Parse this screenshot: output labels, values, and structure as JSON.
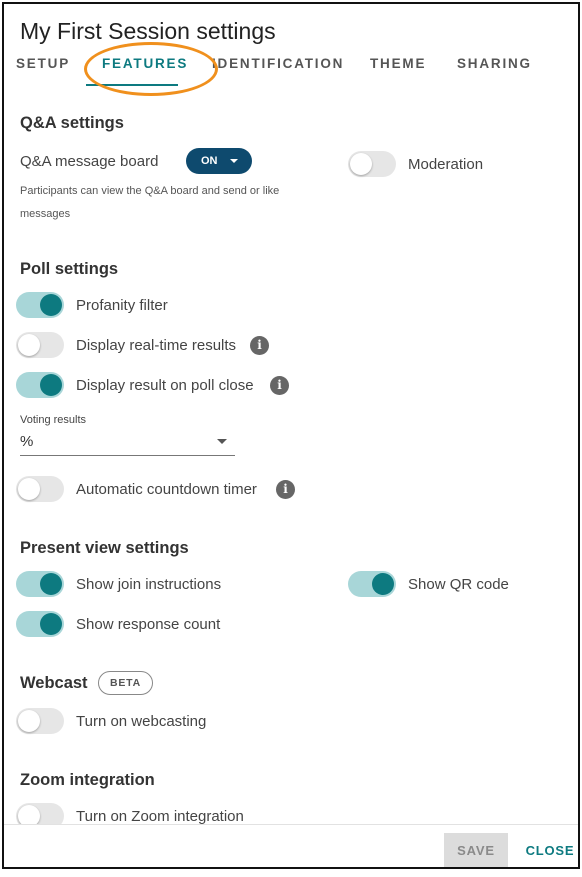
{
  "dialog": {
    "title": "My First Session settings"
  },
  "tabs": [
    {
      "label": "SETUP",
      "active": false
    },
    {
      "label": "FEATURES",
      "active": true
    },
    {
      "label": "IDENTIFICATION",
      "active": false
    },
    {
      "label": "THEME",
      "active": false
    },
    {
      "label": "SHARING",
      "active": false
    }
  ],
  "qa": {
    "title": "Q&A settings",
    "message_board_label": "Q&A message board",
    "message_board_value": "ON",
    "help_text": "Participants can view the Q&A board and send or like messages",
    "moderation_label": "Moderation",
    "moderation_on": false
  },
  "poll": {
    "title": "Poll settings",
    "profanity_label": "Profanity filter",
    "profanity_on": true,
    "realtime_label": "Display real-time results",
    "realtime_on": false,
    "on_close_label": "Display result on poll close",
    "on_close_on": true,
    "voting_results_label": "Voting results",
    "voting_results_value": "%",
    "countdown_label": "Automatic countdown timer",
    "countdown_on": false
  },
  "present": {
    "title": "Present view settings",
    "join_label": "Show join instructions",
    "join_on": true,
    "qr_label": "Show QR code",
    "qr_on": true,
    "response_label": "Show response count",
    "response_on": true
  },
  "webcast": {
    "title": "Webcast",
    "badge": "BETA",
    "toggle_label": "Turn on webcasting",
    "toggle_on": false
  },
  "zoom": {
    "title": "Zoom integration",
    "toggle_label": "Turn on Zoom integration",
    "toggle_on": false
  },
  "footer": {
    "save_label": "SAVE",
    "close_label": "CLOSE"
  },
  "info_glyph": "i",
  "colors": {
    "accent": "#0d7a80",
    "toggle_track_on": "#a8d6d8",
    "pill_bg": "#0e4a6e",
    "annotation": "#f0901d"
  }
}
